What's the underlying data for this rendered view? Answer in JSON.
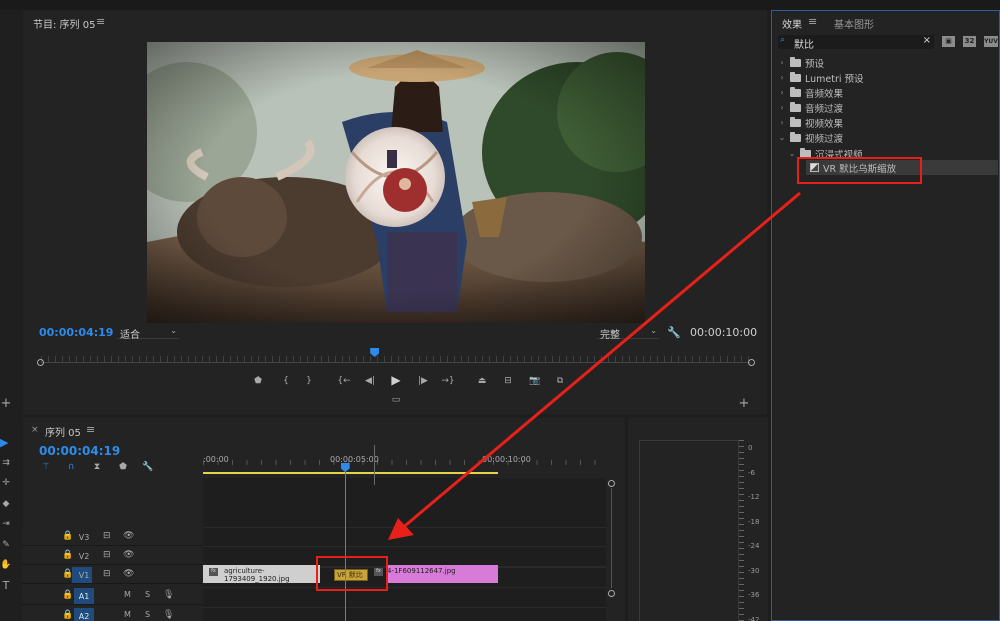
{
  "program_monitor": {
    "title": "节目: 序列 05",
    "menu_icon": "≡",
    "current_timecode": "00:00:04:19",
    "fit_label": "适合",
    "quality_label": "完整",
    "duration": "00:00:10:00",
    "playhead_fraction": 0.47
  },
  "effects_panel": {
    "tab_effects": "效果",
    "tab_menu": "≡",
    "tab_essential_graphics": "基本图形",
    "search_value": "默比",
    "tree": [
      {
        "label": "预设",
        "expanded": false,
        "indent": 0
      },
      {
        "label": "Lumetri 预设",
        "expanded": false,
        "indent": 0
      },
      {
        "label": "音频效果",
        "expanded": false,
        "indent": 0
      },
      {
        "label": "音频过渡",
        "expanded": false,
        "indent": 0
      },
      {
        "label": "视频效果",
        "expanded": false,
        "indent": 0
      },
      {
        "label": "视频过渡",
        "expanded": true,
        "indent": 0
      },
      {
        "label": "沉浸式视频",
        "expanded": true,
        "indent": 1
      },
      {
        "label": "VR 默比乌斯缩放",
        "expanded": false,
        "indent": 2,
        "item": true
      }
    ]
  },
  "timeline": {
    "close_icon": "×",
    "title": "序列 05",
    "menu_icon": "≡",
    "current_timecode": "00:00:04:19",
    "ruler_labels": [
      ":00:00",
      "00:00:05:00",
      "00:00:10:00"
    ],
    "tracks_video": [
      "V3",
      "V2",
      "V1"
    ],
    "tracks_audio": [
      "A1",
      "A2"
    ],
    "audio_mute": "M",
    "audio_solo": "S",
    "clip_a_name": "agriculture-1793409_1920.jpg",
    "clip_b_name": "4-1F609112647.jpg",
    "transition_label": "VR 默比",
    "playhead_fraction": 0.482
  },
  "audio_meter": {
    "labels": [
      "0",
      "-6",
      "-12",
      "-18",
      "-24",
      "-30",
      "-36",
      "-42"
    ]
  },
  "colors": {
    "accent_blue": "#2d8ceb",
    "annotation_red": "#e8201a",
    "clip_b": "#d87ad8",
    "clip_a": "#cfcfcf",
    "transition": "#c9a43a"
  }
}
